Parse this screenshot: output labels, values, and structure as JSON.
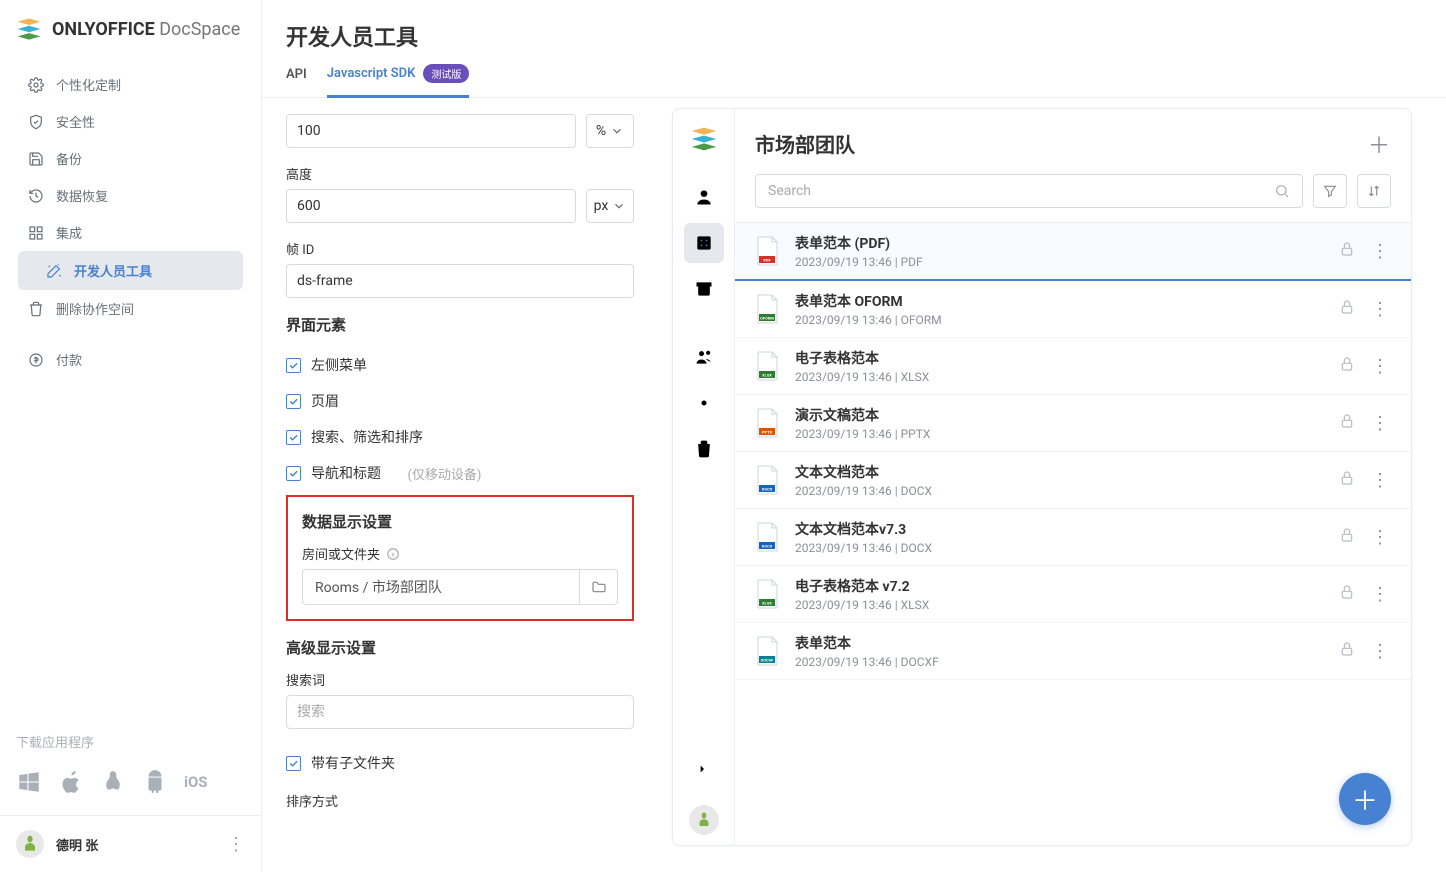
{
  "logo": {
    "brand_bold": "ONLYOFFICE",
    "brand_light": "DocSpace"
  },
  "sidebar": {
    "items": [
      {
        "label": "个性化定制"
      },
      {
        "label": "安全性"
      },
      {
        "label": "备份"
      },
      {
        "label": "数据恢复"
      },
      {
        "label": "集成"
      },
      {
        "label": "开发人员工具"
      },
      {
        "label": "删除协作空间"
      },
      {
        "label": "付款"
      }
    ],
    "download_label": "下载应用程序"
  },
  "user": {
    "name": "德明 张"
  },
  "page": {
    "title": "开发人员工具",
    "tabs": [
      {
        "label": "API"
      },
      {
        "label": "Javascript SDK",
        "badge": "测试版"
      }
    ]
  },
  "form": {
    "width_value": "100",
    "width_unit": "%",
    "height_label": "高度",
    "height_value": "600",
    "height_unit": "px",
    "frame_label": "帧 ID",
    "frame_value": "ds-frame",
    "ui_section": "界面元素",
    "ui_checks": [
      {
        "label": "左侧菜单"
      },
      {
        "label": "页眉"
      },
      {
        "label": "搜索、筛选和排序"
      },
      {
        "label": "导航和标题"
      }
    ],
    "ui_check_mobile_hint": "(仅移动设备)",
    "data_section": "数据显示设置",
    "room_label": "房间或文件夹",
    "room_value": "Rooms / 市场部团队",
    "advanced_section": "高级显示设置",
    "search_label": "搜索词",
    "search_placeholder": "搜索",
    "sub_check_label": "带有子文件夹",
    "sort_label": "排序方式"
  },
  "preview": {
    "title": "市场部团队",
    "search_placeholder": "Search",
    "files": [
      {
        "name": "表单范本 (PDF)",
        "meta": "2023/09/19 13:46 | PDF",
        "ext": "PDF",
        "color": "#d93025"
      },
      {
        "name": "表单范本 OFORM",
        "meta": "2023/09/19 13:46 | OFORM",
        "ext": "OFORM",
        "color": "#2e7d32"
      },
      {
        "name": "电子表格范本",
        "meta": "2023/09/19 13:46 | XLSX",
        "ext": "XLSX",
        "color": "#2e7d32"
      },
      {
        "name": "演示文稿范本",
        "meta": "2023/09/19 13:46 | PPTX",
        "ext": "PPTX",
        "color": "#e65100"
      },
      {
        "name": "文本文档范本",
        "meta": "2023/09/19 13:46 | DOCX",
        "ext": "DOCX",
        "color": "#1565c0"
      },
      {
        "name": "文本文档范本v7.3",
        "meta": "2023/09/19 13:46 | DOCX",
        "ext": "DOCX",
        "color": "#1565c0"
      },
      {
        "name": "电子表格范本 v7.2",
        "meta": "2023/09/19 13:46 | XLSX",
        "ext": "XLSX",
        "color": "#2e7d32"
      },
      {
        "name": "表单范本",
        "meta": "2023/09/19 13:46 | DOCXF",
        "ext": "DOCXF",
        "color": "#00838f"
      }
    ]
  }
}
